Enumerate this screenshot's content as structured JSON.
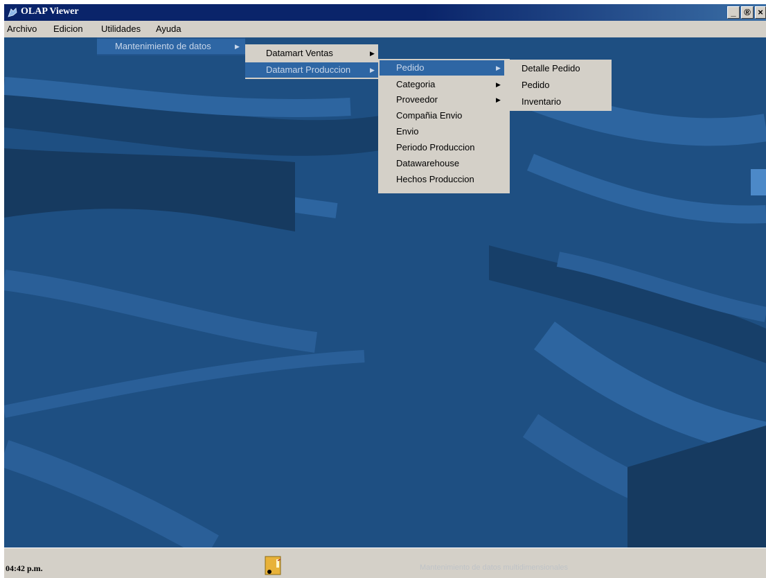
{
  "window": {
    "title": "OLAP Viewer",
    "buttons": {
      "minimize": "_",
      "restore": "®",
      "close": "×"
    }
  },
  "menubar": {
    "items": [
      "Archivo",
      "Edicion",
      "Utilidades",
      "Ayuda"
    ]
  },
  "menus": {
    "utilidades": {
      "items": [
        {
          "label": "Mantenimiento de datos",
          "submenu": true
        }
      ]
    },
    "mantenimiento": {
      "items": [
        {
          "label": "Datamart Ventas",
          "submenu": true
        },
        {
          "label": "Datamart Produccion",
          "submenu": true
        }
      ]
    },
    "produccion": {
      "items": [
        {
          "label": "Pedido",
          "submenu": true
        },
        {
          "label": "Categoria",
          "submenu": true
        },
        {
          "label": "Proveedor",
          "submenu": true
        },
        {
          "label": "Compañia Envio"
        },
        {
          "label": "Envio"
        },
        {
          "label": "Periodo Produccion"
        },
        {
          "label": "Datawarehouse"
        },
        {
          "label": "Hechos Produccion"
        }
      ]
    },
    "pedido": {
      "items": [
        {
          "label": "Detalle Pedido"
        },
        {
          "label": "Pedido"
        },
        {
          "label": "Inventario"
        }
      ]
    }
  },
  "statusbar": {
    "clock": "04:42 p.m.",
    "message": "Mantenimiento de datos multidimensionales"
  },
  "colors": {
    "desktop": "#1e4f82",
    "highlight": "#2e66a4",
    "chrome": "#d4d0c8"
  }
}
